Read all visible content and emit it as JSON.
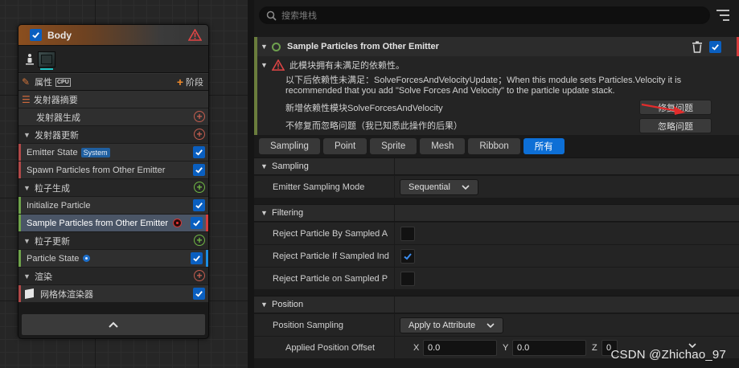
{
  "node": {
    "title": "Body",
    "properties_label": "属性",
    "cpu_badge": "CPU",
    "stage_label": "阶段",
    "rows": [
      {
        "label": "发射器摘要"
      },
      {
        "label": "发射器生成"
      },
      {
        "label": "发射器更新"
      },
      {
        "label": "Emitter State",
        "badge": "System"
      },
      {
        "label": "Spawn Particles from Other Emitter"
      },
      {
        "label": "粒子生成"
      },
      {
        "label": "Initialize Particle"
      },
      {
        "label": "Sample Particles from Other Emitter"
      },
      {
        "label": "粒子更新"
      },
      {
        "label": "Particle State"
      },
      {
        "label": "渲染"
      },
      {
        "label": "网格体渲染器"
      }
    ],
    "footer_icon": "chevron-up-icon",
    "colors": {
      "header_orange": "#8a4e1f",
      "checkbox_blue": "#0a5fc0",
      "warning_red": "#e04545",
      "add_red": "#c25d4f",
      "add_green": "#70b845"
    }
  },
  "panel": {
    "search_placeholder": "搜索堆栈",
    "module_title": "Sample Particles from Other Emitter",
    "issue_header": "此模块拥有未满足的依赖性。",
    "issue_line1": "以下后依赖性未满足：SolveForcesAndVelocityUpdate；When this module sets Particles.Velocity it is",
    "issue_line2": "recommended that you add \"Solve Forces And Velocity\" to the particle update stack.",
    "fix_text": "新增依赖性模块SolveForcesAndVelocity",
    "fix_button": "修复问题",
    "ignore_text": "不修复而忽略问题（我已知悉此操作的后果）",
    "ignore_button": "忽略问题",
    "tabs": [
      "Sampling",
      "Point",
      "Sprite",
      "Mesh",
      "Ribbon",
      "所有"
    ],
    "active_tab": "所有",
    "sections": {
      "sampling": "Sampling",
      "filtering": "Filtering",
      "position": "Position"
    },
    "props": {
      "emitter_sampling_mode_label": "Emitter Sampling Mode",
      "emitter_sampling_mode_value": "Sequential",
      "reject_a_label": "Reject Particle By Sampled A",
      "reject_a_checked": false,
      "reject_b_label": "Reject Particle If Sampled Ind",
      "reject_b_checked": true,
      "reject_c_label": "Reject Particle on Sampled P",
      "reject_c_checked": false,
      "position_sampling_label": "Position Sampling",
      "position_sampling_value": "Apply to Attribute",
      "applied_offset_label": "Applied Position Offset",
      "x_label": "X",
      "x_value": "0.0",
      "y_label": "Y",
      "y_value": "0.0",
      "z_label": "Z",
      "z_value": "0"
    }
  },
  "watermark": "CSDN @Zhichao_97"
}
